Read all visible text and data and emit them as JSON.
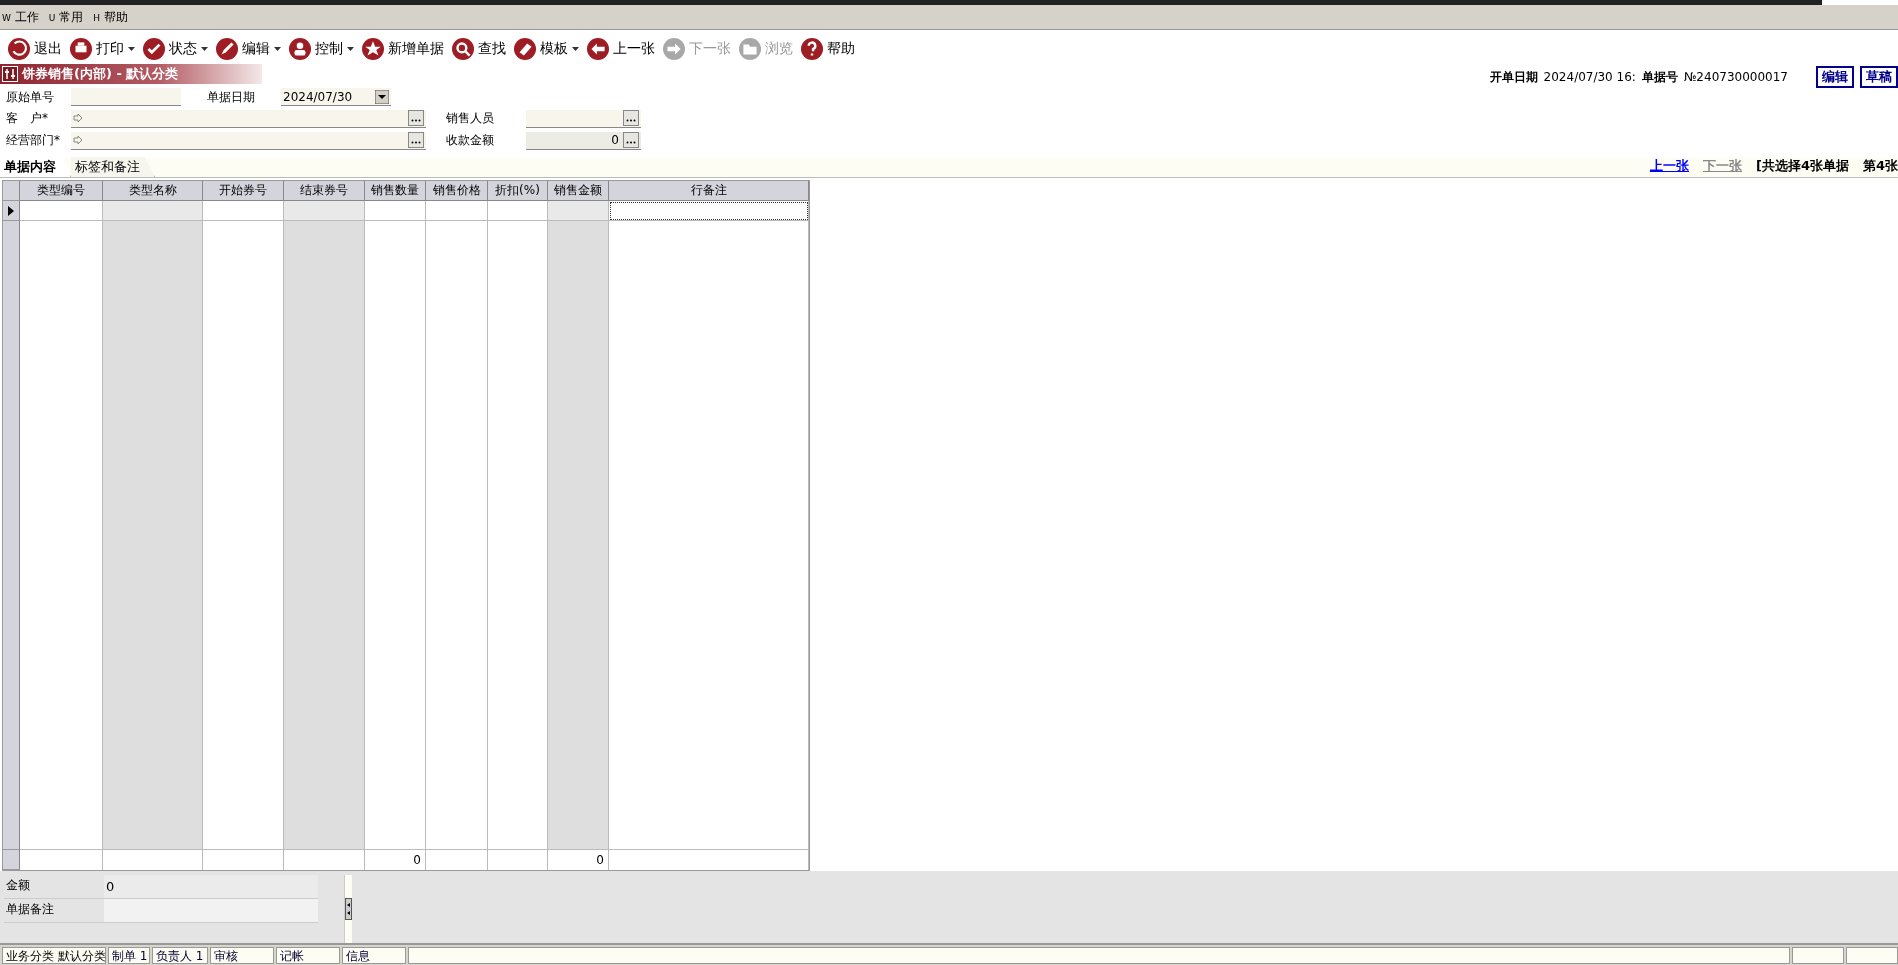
{
  "menu": [
    {
      "key": "W",
      "label": "工作"
    },
    {
      "key": "U",
      "label": "常用"
    },
    {
      "key": "H",
      "label": "帮助"
    }
  ],
  "toolbar": [
    {
      "kind": "undo",
      "label": "退出",
      "dropdown": false,
      "disabled": false
    },
    {
      "kind": "print",
      "label": "打印",
      "dropdown": true,
      "disabled": false
    },
    {
      "kind": "check",
      "label": "状态",
      "dropdown": true,
      "disabled": false
    },
    {
      "kind": "pencil",
      "label": "编辑",
      "dropdown": true,
      "disabled": false
    },
    {
      "kind": "person",
      "label": "控制",
      "dropdown": true,
      "disabled": false
    },
    {
      "kind": "star",
      "label": "新增单据",
      "dropdown": false,
      "disabled": false
    },
    {
      "kind": "search",
      "label": "查找",
      "dropdown": false,
      "disabled": false
    },
    {
      "kind": "eraser",
      "label": "模板",
      "dropdown": true,
      "disabled": false
    },
    {
      "kind": "left",
      "label": "上一张",
      "dropdown": false,
      "disabled": false
    },
    {
      "kind": "right",
      "label": "下一张",
      "dropdown": false,
      "disabled": true
    },
    {
      "kind": "folder",
      "label": "浏览",
      "dropdown": false,
      "disabled": true
    },
    {
      "kind": "help",
      "label": "帮助",
      "dropdown": false,
      "disabled": false
    }
  ],
  "doc_title": "饼券销售(内部) - 默认分类",
  "doc_info": {
    "date_label": "开单日期",
    "date_value": "2024/07/30 16:",
    "number_label": "单据号",
    "number_value": "№240730000017"
  },
  "status_badges": [
    "编辑",
    "草稿"
  ],
  "form": {
    "original_no": {
      "label": "原始单号"
    },
    "doc_date": {
      "label": "单据日期",
      "value": "2024/07/30"
    },
    "customer": {
      "label": "客　户*"
    },
    "dept": {
      "label": "经营部门*"
    },
    "salesperson": {
      "label": "销售人员"
    },
    "amount": {
      "label": "收款金额",
      "value": "0"
    }
  },
  "tabs": [
    {
      "label": "单据内容",
      "selected": true
    },
    {
      "label": "标签和备注",
      "selected": false
    }
  ],
  "nav": {
    "prev": {
      "label": "上一张",
      "disabled": false
    },
    "next": {
      "label": "下一张",
      "disabled": true
    },
    "summary": "[共选择4张单据",
    "position": "第4张"
  },
  "table": {
    "columns": [
      {
        "label": "类型编号",
        "shaded": false
      },
      {
        "label": "类型名称",
        "shaded": true
      },
      {
        "label": "开始券号",
        "shaded": false
      },
      {
        "label": "结束券号",
        "shaded": true
      },
      {
        "label": "销售数量",
        "shaded": false,
        "total": "0"
      },
      {
        "label": "销售价格",
        "shaded": false
      },
      {
        "label": "折扣(%)",
        "shaded": false
      },
      {
        "label": "销售金额",
        "shaded": true,
        "total": "0"
      },
      {
        "label": "行备注",
        "shaded": false
      }
    ]
  },
  "footer": [
    {
      "label": "金额",
      "value": "0"
    },
    {
      "label": "单据备注"
    }
  ],
  "status_bar": [
    "业务分类 默认分类",
    "制单 1",
    "负责人 1",
    "审核",
    "记帐",
    "信息"
  ]
}
